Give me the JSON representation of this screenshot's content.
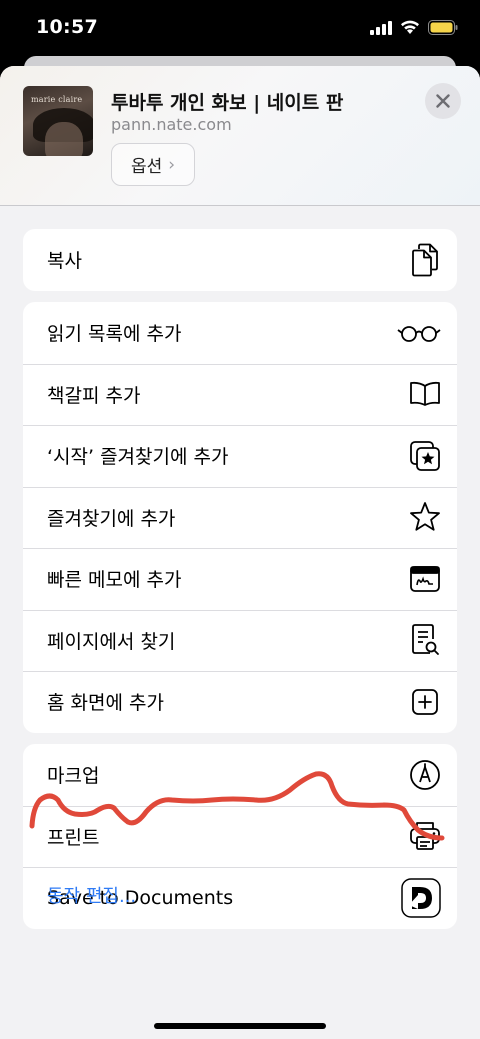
{
  "status_bar": {
    "time": "10:57",
    "signal_icon": "cellular-signal-icon",
    "wifi_icon": "wifi-icon",
    "battery_icon": "battery-icon",
    "battery_color": "#f5d44a"
  },
  "header": {
    "thumbnail_text": "marie claire",
    "title": "투바투 개인 화보 | 네이트 판",
    "url": "pann.nate.com",
    "options_label": "옵션",
    "options_chevron": "›",
    "close_icon": "close-icon"
  },
  "groups": {
    "copy": [
      {
        "label": "복사",
        "icon": "copy-icon"
      }
    ],
    "actions": [
      {
        "label": "읽기 목록에 추가",
        "icon": "glasses-icon"
      },
      {
        "label": "책갈피 추가",
        "icon": "book-icon"
      },
      {
        "label": "‘시작’ 즐겨찾기에 추가",
        "icon": "star-square-icon"
      },
      {
        "label": "즐겨찾기에 추가",
        "icon": "star-icon"
      },
      {
        "label": "빠른 메모에 추가",
        "icon": "quick-note-icon"
      },
      {
        "label": "페이지에서 찾기",
        "icon": "find-in-page-icon"
      },
      {
        "label": "홈 화면에 추가",
        "icon": "add-square-icon"
      }
    ],
    "extra": [
      {
        "label": "마크업",
        "icon": "markup-pen-icon"
      },
      {
        "label": "프린트",
        "icon": "printer-icon"
      },
      {
        "label": "Save to Documents",
        "icon": "documents-app-icon"
      }
    ]
  },
  "edit_actions_label": "동작 편집...",
  "colors": {
    "accent_blue": "#2f7bf5",
    "scribble_red": "#e0493a"
  }
}
